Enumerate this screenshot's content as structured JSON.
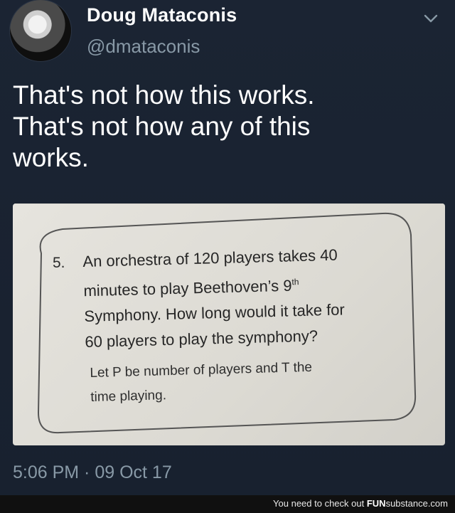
{
  "tweet": {
    "display_name": "Doug Mataconis",
    "handle": "@dmataconis",
    "text_lines": [
      "That's not how this works.",
      "That's not how any of this",
      "works."
    ],
    "timestamp": "5:06 PM · 09 Oct 17"
  },
  "photo": {
    "question_number": "5.",
    "question_lines": [
      "An orchestra of 120 players takes 40",
      "minutes to play Beethoven’s 9",
      "Symphony. How long would it take for",
      "60 players to play the symphony?"
    ],
    "superscript": "th",
    "hint_lines": [
      "Let P be number of players and T the",
      "time playing."
    ]
  },
  "footer": {
    "prefix": "You need to check out ",
    "brand_bold": "FUN",
    "brand_rest": "substance.com"
  },
  "colors": {
    "background": "#1b2433",
    "handle_gray": "#8899a6",
    "paper": "#e6e4de"
  },
  "icons": {
    "menu": "chevron-down-icon",
    "avatar": "profile-photo"
  }
}
